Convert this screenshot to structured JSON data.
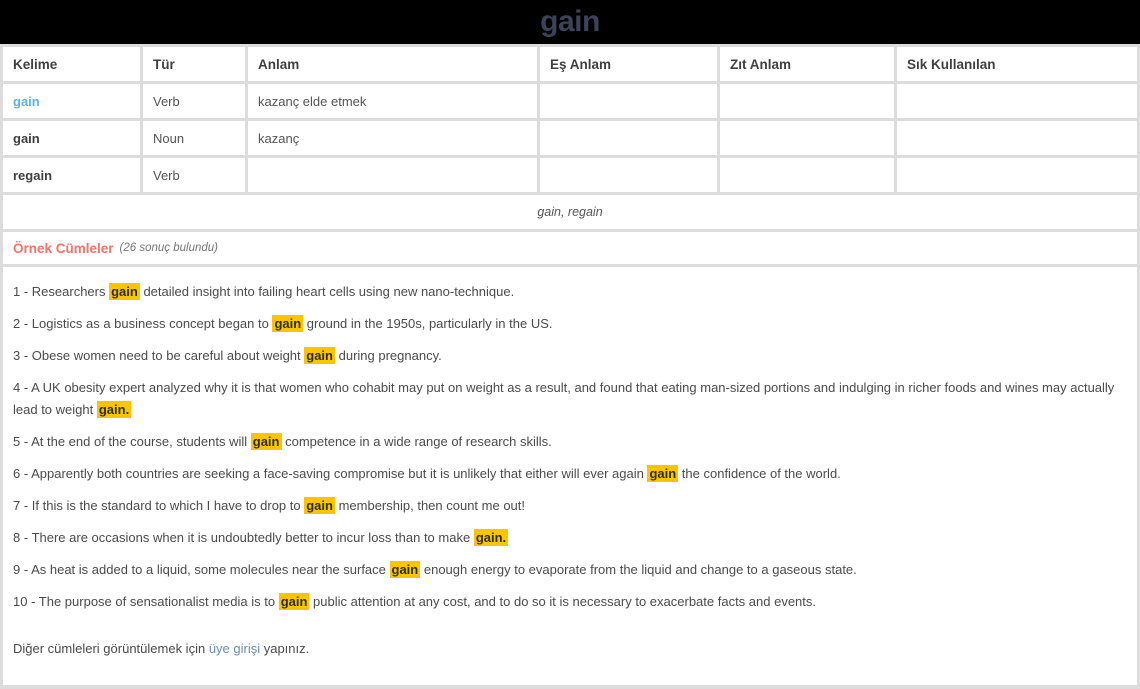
{
  "header": {
    "title": "gain"
  },
  "table": {
    "columns": [
      "Kelime",
      "Tür",
      "Anlam",
      "Eş Anlam",
      "Zıt Anlam",
      "Sık Kullanılan"
    ],
    "rows": [
      {
        "kelime": "gain",
        "tur": "Verb",
        "anlam": "kazanç elde etmek",
        "es_anlam": "",
        "zit_anlam": "",
        "sik_kullanilan": "",
        "kelime_is_link": true
      },
      {
        "kelime": "gain",
        "tur": "Noun",
        "anlam": "kazanç",
        "es_anlam": "",
        "zit_anlam": "",
        "sik_kullanilan": "",
        "kelime_is_link": false
      },
      {
        "kelime": "regain",
        "tur": "Verb",
        "anlam": "",
        "es_anlam": "",
        "zit_anlam": "",
        "sik_kullanilan": "",
        "kelime_is_link": false
      }
    ],
    "related_words": "gain, regain"
  },
  "examples": {
    "title": "Örnek Cümleler",
    "count_label": "(26 sonuç bulundu)",
    "highlight_color": "#fbc400",
    "sentences": [
      {
        "index": "1 - ",
        "before": "Researchers ",
        "highlight": "gain",
        "after": " detailed insight into failing heart cells using new nano-technique."
      },
      {
        "index": "2 - ",
        "before": "Logistics as a business concept began to ",
        "highlight": "gain",
        "after": " ground in the 1950s, particularly in the US."
      },
      {
        "index": "3 - ",
        "before": "Obese women need to be careful about weight ",
        "highlight": "gain",
        "after": " during pregnancy."
      },
      {
        "index": "4 - ",
        "before": "A UK obesity expert analyzed why it is that women who cohabit may put on weight as a result, and found that eating man-sized portions and indulging in richer foods and wines may actually lead to weight ",
        "highlight": "gain.",
        "after": ""
      },
      {
        "index": "5 - ",
        "before": "At the end of the course, students will ",
        "highlight": "gain",
        "after": " competence in a wide range of research skills."
      },
      {
        "index": "6 - ",
        "before": "Apparently both countries are seeking a face-saving compromise but it is unlikely that either will ever again ",
        "highlight": "gain",
        "after": " the confidence of the world."
      },
      {
        "index": "7 - ",
        "before": "If this is the standard to which I have to drop to ",
        "highlight": "gain",
        "after": " membership, then count me out!"
      },
      {
        "index": "8 - ",
        "before": "There are occasions when it is undoubtedly better to incur loss than to make ",
        "highlight": "gain.",
        "after": ""
      },
      {
        "index": "9 - ",
        "before": "As heat is added to a liquid, some molecules near the surface ",
        "highlight": "gain",
        "after": " enough energy to evaporate from the liquid and change to a gaseous state."
      },
      {
        "index": "10 - ",
        "before": "The purpose of sensationalist media is to ",
        "highlight": "gain",
        "after": " public attention at any cost, and to do so it is necessary to exacerbate facts and events."
      }
    ],
    "login_prompt_before": "Diğer cümleleri görüntülemek için ",
    "login_link": "üye girişi",
    "login_prompt_after": " yapınız."
  },
  "colors": {
    "title": "#3c4358",
    "link": "#5cb3e8",
    "accent": "#f4736b",
    "highlight": "#fbc400",
    "login_link": "#6d8fb5"
  }
}
